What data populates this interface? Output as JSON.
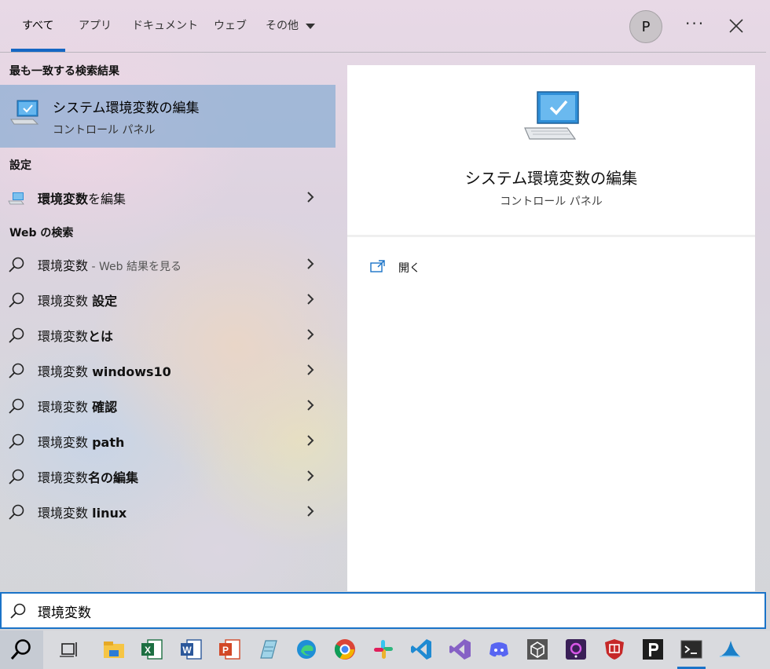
{
  "tabs": [
    {
      "label": "すべて"
    },
    {
      "label": "アプリ"
    },
    {
      "label": "ドキュメント"
    },
    {
      "label": "ウェブ"
    },
    {
      "label": "その他"
    }
  ],
  "user": {
    "initial": "P"
  },
  "more_label": "···",
  "best_match": {
    "heading": "最も一致する検索結果",
    "title": "システム環境変数の編集",
    "subtitle": "コントロール パネル"
  },
  "settings": {
    "heading": "設定",
    "item": {
      "bold": "環境変数",
      "rest": "を編集"
    }
  },
  "web": {
    "heading": "Web の検索",
    "items": [
      {
        "plain": "環境変数",
        "bold": "",
        "dim": " - Web 結果を見る"
      },
      {
        "plain": "環境変数 ",
        "bold": "設定",
        "dim": ""
      },
      {
        "plain": "環境変数",
        "bold": "とは",
        "dim": ""
      },
      {
        "plain": "環境変数 ",
        "bold": "windows10",
        "dim": ""
      },
      {
        "plain": "環境変数 ",
        "bold": "確認",
        "dim": ""
      },
      {
        "plain": "環境変数 ",
        "bold": "path",
        "dim": ""
      },
      {
        "plain": "環境変数",
        "bold": "名の編集",
        "dim": ""
      },
      {
        "plain": "環境変数 ",
        "bold": "linux",
        "dim": ""
      }
    ]
  },
  "preview": {
    "title": "システム環境変数の編集",
    "subtitle": "コントロール パネル",
    "action_open": "開く"
  },
  "search": {
    "value": "環境変数"
  },
  "colors": {
    "accent": "#1a73c8",
    "highlight": "#8fb6d9"
  },
  "taskbar_icons": [
    "search-icon",
    "task-view-icon",
    "file-explorer-icon",
    "excel-icon",
    "word-icon",
    "powerpoint-icon",
    "notepad-icon",
    "edge-icon",
    "chrome-icon",
    "slack-icon",
    "vscode-icon",
    "visual-studio-icon",
    "discord-icon",
    "unity-icon",
    "app-icon",
    "shield-app-icon",
    "p-app-icon",
    "terminal-icon",
    "shark-app-icon"
  ]
}
